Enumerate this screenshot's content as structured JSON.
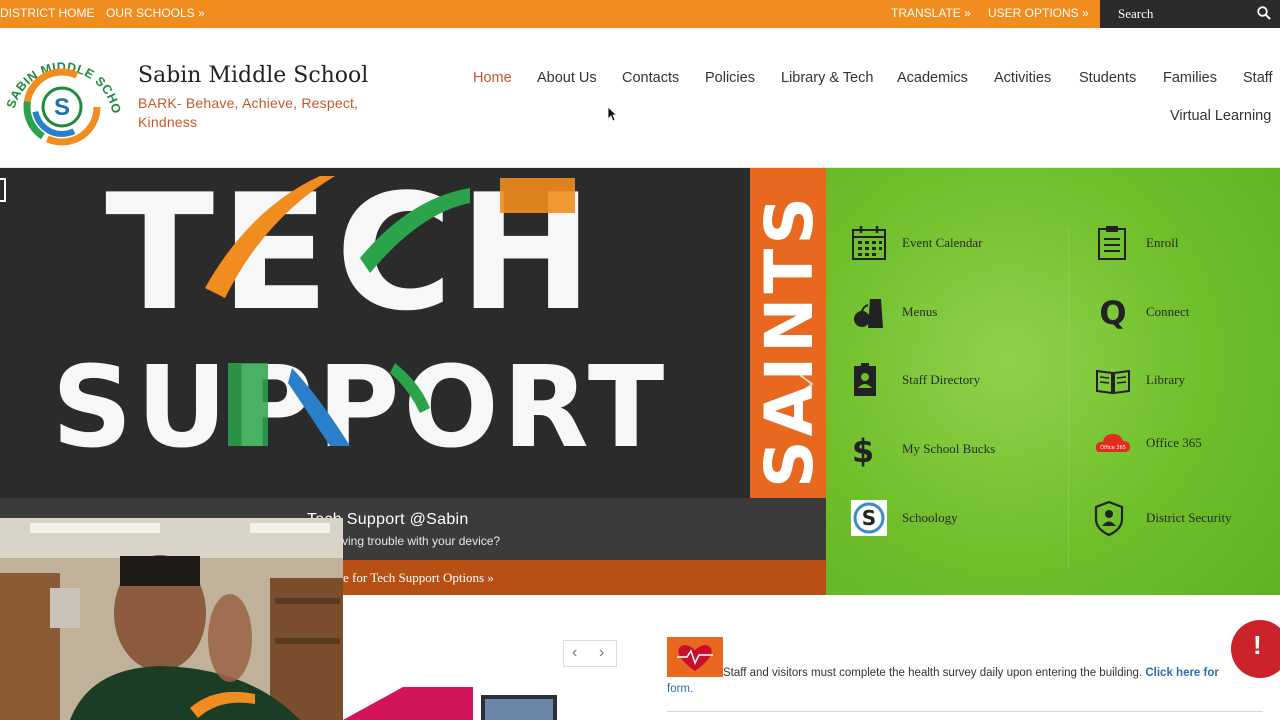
{
  "topbar": {
    "district_home": "DISTRICT HOME",
    "our_schools": "OUR SCHOOLS »",
    "translate": "TRANSLATE »",
    "user_options": "USER OPTIONS »",
    "search_placeholder": "Search"
  },
  "header": {
    "school_name": "Sabin Middle School",
    "tagline": "BARK- Behave, Achieve, Respect, Kindness",
    "logo_text": "SABIN MIDDLE SCHOOL"
  },
  "nav": {
    "items": [
      "Home",
      "About Us",
      "Contacts",
      "Policies",
      "Library & Tech",
      "Academics",
      "Activities",
      "Students",
      "Families",
      "Staff",
      "Virtual Learning"
    ],
    "active": "Home"
  },
  "hero": {
    "title": "Tech Support @Sabin",
    "subtitle": "ving trouble with your device?",
    "link": "e for Tech Support Options »",
    "image_text_line1": "TECH",
    "image_text_line2": "SUPPORT",
    "side_text": "SAINTS"
  },
  "quick_links": [
    {
      "label": "Event Calendar",
      "icon": "calendar-icon"
    },
    {
      "label": "Enroll",
      "icon": "clipboard-icon"
    },
    {
      "label": "Menus",
      "icon": "apple-bag-icon"
    },
    {
      "label": "Connect",
      "icon": "q-icon"
    },
    {
      "label": "Staff Directory",
      "icon": "badge-icon"
    },
    {
      "label": "Library",
      "icon": "book-icon"
    },
    {
      "label": "My School Bucks",
      "icon": "dollar-icon"
    },
    {
      "label": "Office 365",
      "icon": "office-cloud-icon"
    },
    {
      "label": "Schoology",
      "icon": "schoology-icon"
    },
    {
      "label": "District Security",
      "icon": "shield-icon"
    }
  ],
  "notice": {
    "text": "Staff and visitors must complete the health survey daily upon entering the building.",
    "link": "Click here for",
    "link_end": "form."
  },
  "colors": {
    "topbar": "#f08d1e",
    "accent": "#c8572a",
    "quick_links_bg": "#6fbf2b",
    "alert": "#cc2229"
  }
}
